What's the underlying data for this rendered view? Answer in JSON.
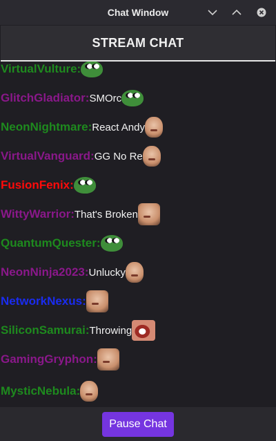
{
  "window": {
    "title": "Chat Window"
  },
  "header": {
    "title": "STREAM CHAT"
  },
  "messages": [
    {
      "user": "VirtualVulture:",
      "color": "#1e8a1e",
      "text": "",
      "emote": "pepe-emote",
      "emote_kind": "pepe"
    },
    {
      "user": "GlitchGladiator:",
      "color": "#8a188a",
      "text": "SMOrc",
      "emote": "pepe-emote",
      "emote_kind": "pepe"
    },
    {
      "user": "NeonNightmare:",
      "color": "#1e8a1e",
      "text": "React Andy",
      "emote": "face-emote",
      "emote_kind": "face"
    },
    {
      "user": "VirtualVanguard:",
      "color": "#8a188a",
      "text": "GG No Re",
      "emote": "face-emote",
      "emote_kind": "face"
    },
    {
      "user": "FusionFenix:",
      "color": "#ff0a0a",
      "text": "",
      "emote": "pepe-emote",
      "emote_kind": "pepe"
    },
    {
      "user": "WittyWarrior:",
      "color": "#8a188a",
      "text": "That's Broken",
      "emote": "face-emote",
      "emote_kind": "face-big"
    },
    {
      "user": "QuantumQuester:",
      "color": "#1e8a1e",
      "text": "",
      "emote": "pepe-emote",
      "emote_kind": "pepe"
    },
    {
      "user": "NeonNinja2023:",
      "color": "#8a188a",
      "text": "Unlucky",
      "emote": "face-emote",
      "emote_kind": "face"
    },
    {
      "user": "NetworkNexus:",
      "color": "#1a2cf0",
      "text": "",
      "emote": "face-emote",
      "emote_kind": "face-big"
    },
    {
      "user": "SiliconSamurai:",
      "color": "#1e8a1e",
      "text": "Throwing",
      "emote": "mouth-emote",
      "emote_kind": "mouth"
    },
    {
      "user": "GamingGryphon:",
      "color": "#8a188a",
      "text": "",
      "emote": "face-emote",
      "emote_kind": "face-big"
    },
    {
      "user": "MysticNebula:",
      "color": "#1e8a1e",
      "text": "",
      "emote": "face-emote",
      "emote_kind": "face"
    }
  ],
  "footer": {
    "pause_label": "Pause Chat"
  },
  "colors": {
    "accent": "#7535e0"
  }
}
